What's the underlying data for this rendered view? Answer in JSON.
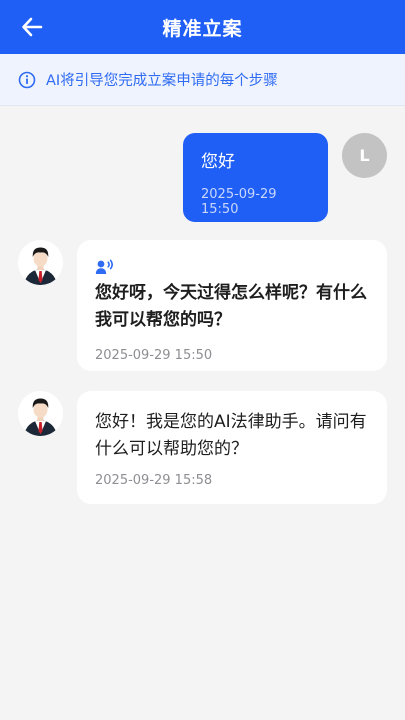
{
  "header": {
    "title": "精准立案",
    "back_icon": "arrow-left-icon"
  },
  "notice": {
    "icon": "info-circle-icon",
    "text": "AI将引导您完成立案申请的每个步骤"
  },
  "messages": [
    {
      "sender": "user",
      "avatar_letter": "L",
      "text": "您好",
      "time": "2025-09-29 15:50"
    },
    {
      "sender": "assistant",
      "avatar": "lawyer-avatar-icon",
      "has_audio_icon": true,
      "text": "您好呀，今天过得怎么样呢？有什么我可以帮您的吗？",
      "time": "2025-09-29 15:50"
    },
    {
      "sender": "assistant",
      "avatar": "lawyer-avatar-icon",
      "has_audio_icon": false,
      "text": "您好！我是您的AI法律助手。请问有什么可以帮助您的？",
      "time": "2025-09-29 15:58"
    }
  ],
  "colors": {
    "primary": "#1f5ff6",
    "notice_bg": "#eff3fe",
    "page_bg": "#f4f4f5",
    "user_avatar_bg": "#c3c3c3"
  }
}
